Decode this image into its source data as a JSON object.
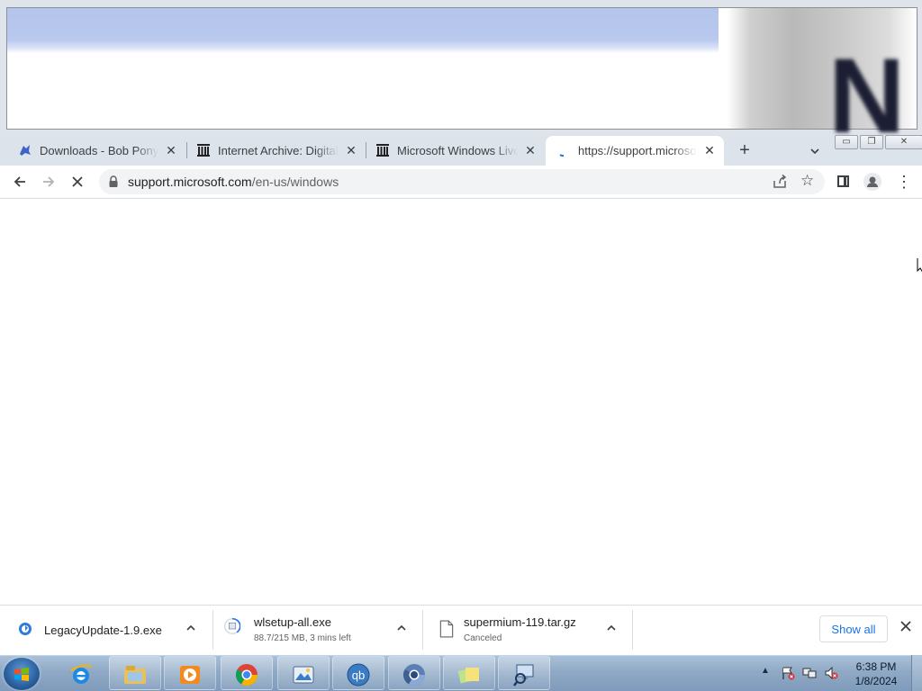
{
  "browser": {
    "tabs": [
      {
        "title": "Downloads - Bob Pony",
        "favicon": "bob-pony-favicon"
      },
      {
        "title": "Internet Archive: Digital Library",
        "favicon": "internet-archive-icon"
      },
      {
        "title": "Microsoft Windows Live Essentials",
        "favicon": "internet-archive-icon"
      },
      {
        "title": "https://support.microsoft.com/en-us/windows",
        "favicon": "loading-spinner",
        "active": true
      }
    ],
    "address_bar": {
      "host": "support.microsoft.com",
      "path": "/en-us/windows"
    }
  },
  "downloads": [
    {
      "name": "LegacyUpdate-1.9.exe",
      "status": ""
    },
    {
      "name": "wlsetup-all.exe",
      "status": "88.7/215 MB, 3 mins left"
    },
    {
      "name": "supermium-119.tar.gz",
      "status": "Canceled"
    }
  ],
  "downloads_show_all": "Show all",
  "taskbar": {
    "apps": [
      "internet-explorer",
      "windows-explorer",
      "windows-media-player",
      "google-chrome",
      "photo-viewer",
      "qbittorrent",
      "chromium",
      "sticky-notes",
      "network-search"
    ],
    "clock": {
      "time": "6:38 PM",
      "date": "1/8/2024"
    }
  },
  "colors": {
    "accent": "#1a73e8",
    "tabstrip": "#dde3ea",
    "taskbar": "#8fa9c5"
  }
}
